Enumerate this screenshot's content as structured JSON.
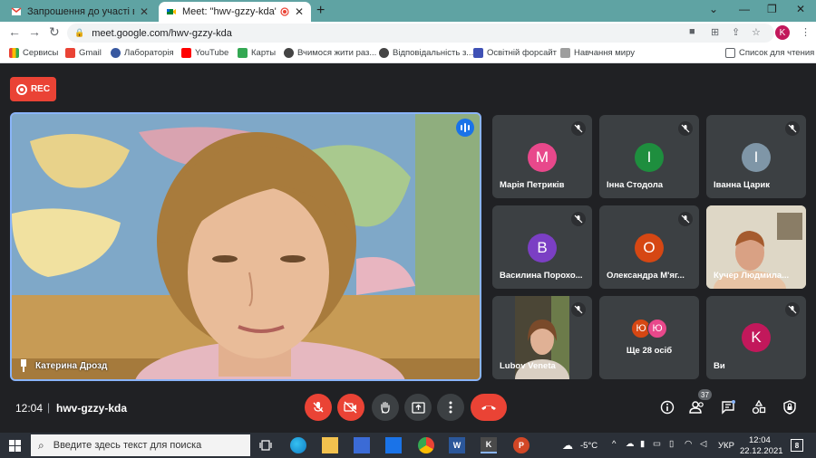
{
  "browser": {
    "tabs": [
      {
        "title": "Запрошення до участі в освітн",
        "favicon": "gmail-icon",
        "active": false
      },
      {
        "title": "Meet: \"hwv-gzzy-kda\"",
        "favicon": "meet-icon",
        "active": true
      }
    ],
    "url": "meet.google.com/hwv-gzzy-kda",
    "profile_initial": "K",
    "bookmarks": [
      {
        "label": "Сервисы",
        "icon": "apps-icon",
        "color": "#4285f4"
      },
      {
        "label": "Gmail",
        "icon": "gmail-icon",
        "color": "#ea4335"
      },
      {
        "label": "Лабораторія",
        "icon": "wordpress-icon",
        "color": "#3858a0"
      },
      {
        "label": "YouTube",
        "icon": "youtube-icon",
        "color": "#ff0000"
      },
      {
        "label": "Карты",
        "icon": "maps-icon",
        "color": "#34a853"
      },
      {
        "label": "Вчимося жити раз...",
        "icon": "globe-icon",
        "color": "#444444"
      },
      {
        "label": "Відповідальність з...",
        "icon": "globe-icon",
        "color": "#444444"
      },
      {
        "label": "Освітній форсайт",
        "icon": "forms-icon",
        "color": "#3f51b5"
      },
      {
        "label": "Навчання миру",
        "icon": "bird-icon",
        "color": "#888888"
      }
    ],
    "reading_list": "Список для чтения"
  },
  "meet": {
    "rec_label": "REC",
    "main_speaker": "Катерина Дрозд",
    "participants": [
      {
        "name": "Марія Петриків",
        "initial": "M",
        "color": "#e8488b"
      },
      {
        "name": "Інна Стодола",
        "initial": "I",
        "color": "#1e8e3e"
      },
      {
        "name": "Іванна Царик",
        "initial": "I",
        "color": "#7f96a7"
      },
      {
        "name": "Василина Порохо...",
        "initial": "B",
        "color": "#7b3fc4"
      },
      {
        "name": "Олександра М'яг...",
        "initial": "O",
        "color": "#d64713"
      },
      {
        "name": "Кучер Людмила...",
        "initial": "",
        "color": "#d8d0b8"
      },
      {
        "name": "Lubov Veneta",
        "initial": "",
        "color": "#6b5a4a"
      },
      {
        "name": "Ще 28 осіб",
        "initial": "Ю",
        "color": "#e8488b"
      },
      {
        "name": "Ви",
        "initial": "K",
        "color": "#c2185b"
      }
    ],
    "time": "12:04",
    "separator": "|",
    "meeting_code": "hwv-gzzy-kda",
    "participant_count": "37"
  },
  "taskbar": {
    "search_placeholder": "Введите здесь текст для поиска",
    "weather": "-5°C",
    "language": "УКР",
    "clock_time": "12:04",
    "clock_date": "22.12.2021",
    "notifications": "8"
  }
}
